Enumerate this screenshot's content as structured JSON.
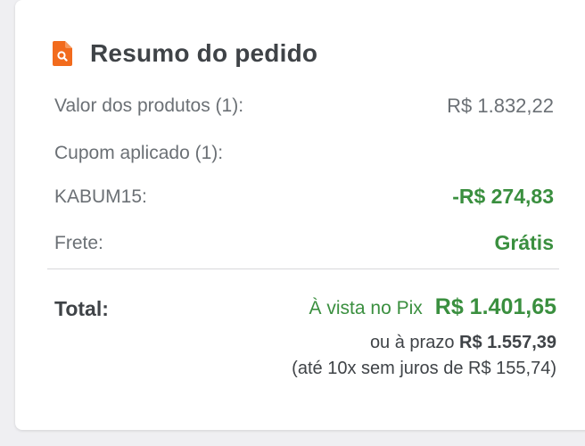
{
  "summary": {
    "title": "Resumo do pedido",
    "icon": "document-search-icon",
    "accent_color": "#f26b1d",
    "rows": {
      "produtos": {
        "label": "Valor dos produtos (1):",
        "value": "R$ 1.832,22"
      },
      "cupom": {
        "label": "Cupom aplicado (1):"
      },
      "codigo": {
        "label": "KABUM15:",
        "value": "-R$ 274,83"
      },
      "frete": {
        "label": "Frete:",
        "value": "Grátis"
      }
    },
    "total": {
      "label": "Total:",
      "pix_label": "À vista no Pix",
      "pix_value": "R$ 1.401,65",
      "prazo_prefix": "ou à prazo",
      "prazo_value": "R$ 1.557,39",
      "parcelas": "(até 10x sem juros de R$ 155,74)"
    },
    "colors": {
      "green": "#3a8f3f",
      "text_dark": "#3f4347",
      "text_muted": "#6b7075"
    }
  }
}
